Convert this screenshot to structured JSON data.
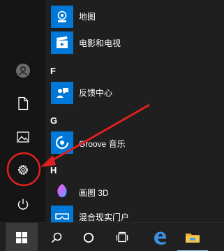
{
  "rail": {
    "user_icon": "user-icon",
    "document_icon": "document-icon",
    "pictures_icon": "pictures-icon",
    "settings_icon": "gear-icon",
    "power_icon": "power-icon"
  },
  "app_list": {
    "apps_top": [
      {
        "label": "地图",
        "icon": "maps-icon",
        "color": "#0078d7"
      },
      {
        "label": "电影和电视",
        "icon": "movies-icon",
        "color": "#0078d7"
      }
    ],
    "group_f": {
      "letter": "F",
      "apps": [
        {
          "label": "反馈中心",
          "icon": "feedback-icon",
          "color": "#0078d7"
        }
      ]
    },
    "group_g": {
      "letter": "G",
      "apps": [
        {
          "label": "Groove 音乐",
          "icon": "groove-icon",
          "color": "#0078d7"
        }
      ]
    },
    "group_h": {
      "letter": "H",
      "apps": [
        {
          "label": "画图 3D",
          "icon": "paint3d-icon",
          "color": "#1f1f1f"
        },
        {
          "label": "混合现实门户",
          "icon": "mixed-reality-icon",
          "color": "#0078d7"
        }
      ]
    }
  },
  "taskbar": {
    "start_icon": "windows-icon",
    "search_icon": "search-icon",
    "cortana_icon": "cortana-icon",
    "taskview_icon": "task-view-icon",
    "edge_icon": "edge-icon",
    "explorer_icon": "file-explorer-icon"
  },
  "colors": {
    "accent": "#0078d7",
    "annotation": "#e02020",
    "background": "#1f1f1f",
    "rail": "#151515"
  }
}
